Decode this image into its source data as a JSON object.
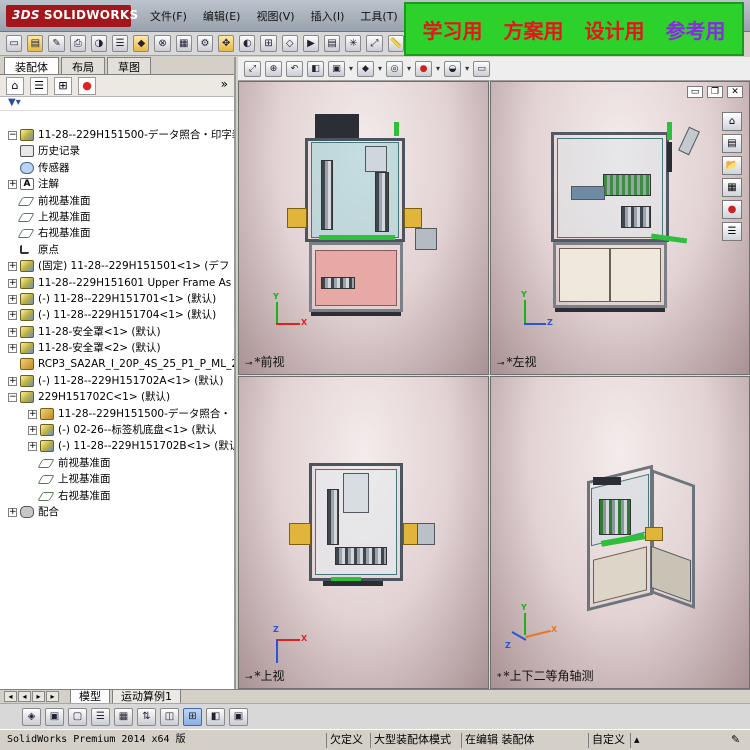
{
  "app": {
    "logo_text": "SOLIDWORKS",
    "logo_mark": "3DS"
  },
  "menu": [
    "文件(F)",
    "编辑(E)",
    "视图(V)",
    "插入(I)",
    "工具(T)"
  ],
  "banner": {
    "items": [
      {
        "text": "学习用",
        "color": "#e8141c"
      },
      {
        "text": "方案用",
        "color": "#e8141c"
      },
      {
        "text": "设计用",
        "color": "#e8141c"
      },
      {
        "text": "参考用",
        "color": "#8a2be2"
      }
    ]
  },
  "left_tabs": [
    "装配体",
    "布局",
    "草图"
  ],
  "tree": [
    {
      "label": "11-28--229H151500-データ照合・印字装",
      "icon": "assy",
      "level": 0,
      "expander": "-"
    },
    {
      "label": "历史记录",
      "icon": "hist",
      "level": 1,
      "expander": ""
    },
    {
      "label": "传感器",
      "icon": "sensor",
      "level": 1,
      "expander": ""
    },
    {
      "label": "注解",
      "icon": "note",
      "level": 1,
      "expander": "+"
    },
    {
      "label": "前视基准面",
      "icon": "plane",
      "level": 1,
      "expander": ""
    },
    {
      "label": "上视基准面",
      "icon": "plane",
      "level": 1,
      "expander": ""
    },
    {
      "label": "右视基准面",
      "icon": "plane",
      "level": 1,
      "expander": ""
    },
    {
      "label": "原点",
      "icon": "origin",
      "level": 1,
      "expander": ""
    },
    {
      "label": "(固定) 11-28--229H151501<1> (デフ",
      "icon": "assy",
      "level": 1,
      "expander": "+"
    },
    {
      "label": "11-28--229H151601 Upper Frame As",
      "icon": "assy",
      "level": 1,
      "expander": "+"
    },
    {
      "label": "(-) 11-28--229H151701<1> (默认)",
      "icon": "assy",
      "level": 1,
      "expander": "+"
    },
    {
      "label": "(-) 11-28--229H151704<1> (默认)",
      "icon": "assy",
      "level": 1,
      "expander": "+"
    },
    {
      "label": "11-28-安全罩<1> (默认)",
      "icon": "assy",
      "level": 1,
      "expander": "+"
    },
    {
      "label": "11-28-安全罩<2> (默认)",
      "icon": "assy",
      "level": 1,
      "expander": "+"
    },
    {
      "label": "RCP3_SA2AR_I_20P_4S_25_P1_P_ML_20",
      "icon": "part",
      "level": 1,
      "expander": ""
    },
    {
      "label": "(-) 11-28--229H151702A<1> (默认)",
      "icon": "assy",
      "level": 1,
      "expander": "+"
    },
    {
      "label": "229H151702C<1> (默认)",
      "icon": "assy",
      "level": 0,
      "expander": "-"
    },
    {
      "label": "11-28--229H151500-データ照合・",
      "icon": "part",
      "level": 2,
      "expander": "+"
    },
    {
      "label": "(-) 02-26--标签机底盘<1> (默认",
      "icon": "assy",
      "level": 2,
      "expander": "+"
    },
    {
      "label": "(-) 11-28--229H151702B<1> (默认",
      "icon": "assy",
      "level": 2,
      "expander": "+"
    },
    {
      "label": "前视基准面",
      "icon": "plane",
      "level": 2,
      "expander": ""
    },
    {
      "label": "上视基准面",
      "icon": "plane",
      "level": 2,
      "expander": ""
    },
    {
      "label": "右视基准面",
      "icon": "plane",
      "level": 2,
      "expander": ""
    },
    {
      "label": "配合",
      "icon": "mate",
      "level": 0,
      "expander": "+"
    }
  ],
  "viewports": {
    "front": "*前视",
    "left": "*左视",
    "top": "*上视",
    "iso": "*上下二等角轴测"
  },
  "bottom_tabs": [
    "模型",
    "运动算例1"
  ],
  "status": {
    "product": "SolidWorks Premium 2014 x64 版",
    "cell1": "欠定义",
    "cell2": "大型装配体模式",
    "cell3": "在编辑 装配体",
    "cell4": "自定义"
  },
  "colors": {
    "banner_bg": "#2cd12c",
    "viewport_bg": "#e2d2d3",
    "logo_bg": "#a3161c"
  }
}
